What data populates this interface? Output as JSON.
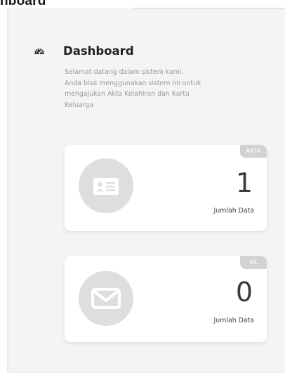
{
  "header": {
    "title_partial": "nboard"
  },
  "dashboard": {
    "title": "Dashboard",
    "icon": "tachometer-icon",
    "welcome_text": "Selamat datang dalam sistem kami.\nAnda bisa menggunakan sistem ini untuk\nmengajukan Akta Kelahiran dan Kartu\nKeluarga"
  },
  "cards": [
    {
      "badge": "AKTA",
      "count": "1",
      "count_label": "Jumlah Data",
      "icon": "id-card-icon"
    },
    {
      "badge": "KK",
      "count": "0",
      "count_label": "Jumlah Data",
      "icon": "envelope-icon"
    }
  ],
  "colors": {
    "panel_bg": "#f4f4f4",
    "card_bg": "#ffffff",
    "badge_bg": "#d2d2d2",
    "icon_circle": "#dedede",
    "muted_text": "#9a9a9a"
  }
}
